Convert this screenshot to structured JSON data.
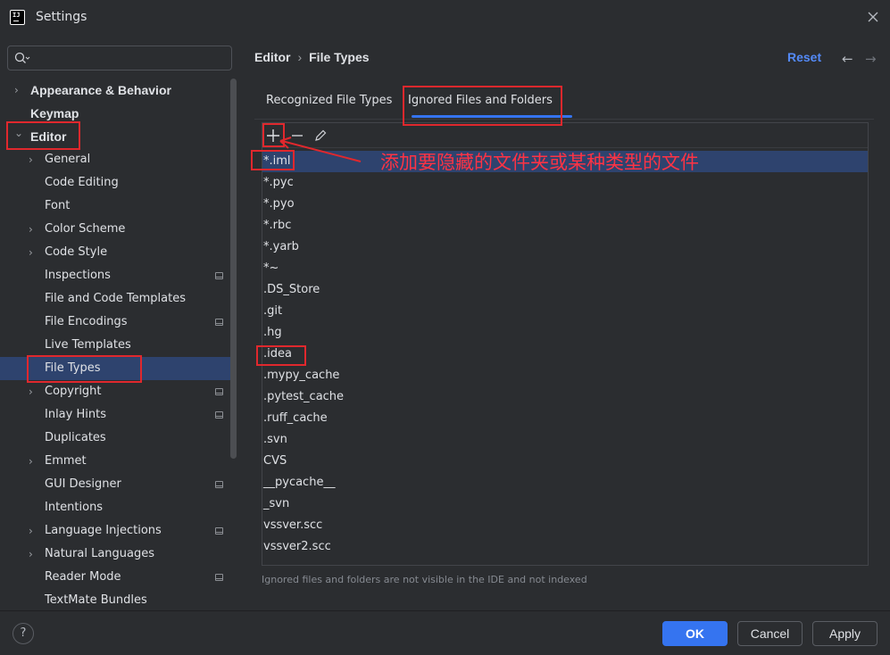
{
  "window": {
    "title": "Settings",
    "logo_text": "IJ"
  },
  "search": {
    "placeholder": "",
    "value": ""
  },
  "sidebar": {
    "items": [
      {
        "label": "Appearance & Behavior",
        "level": 0,
        "chevron": "right",
        "bold": true
      },
      {
        "label": "Keymap",
        "level": 0,
        "chevron": "",
        "bold": true
      },
      {
        "label": "Editor",
        "level": 0,
        "chevron": "down",
        "bold": true
      },
      {
        "label": "General",
        "level": 1,
        "chevron": "right"
      },
      {
        "label": "Code Editing",
        "level": 1,
        "chevron": ""
      },
      {
        "label": "Font",
        "level": 1,
        "chevron": ""
      },
      {
        "label": "Color Scheme",
        "level": 1,
        "chevron": "right"
      },
      {
        "label": "Code Style",
        "level": 1,
        "chevron": "right"
      },
      {
        "label": "Inspections",
        "level": 1,
        "chevron": "",
        "project_icon": true
      },
      {
        "label": "File and Code Templates",
        "level": 1,
        "chevron": ""
      },
      {
        "label": "File Encodings",
        "level": 1,
        "chevron": "",
        "project_icon": true
      },
      {
        "label": "Live Templates",
        "level": 1,
        "chevron": ""
      },
      {
        "label": "File Types",
        "level": 1,
        "chevron": "",
        "selected": true
      },
      {
        "label": "Copyright",
        "level": 1,
        "chevron": "right",
        "project_icon": true
      },
      {
        "label": "Inlay Hints",
        "level": 1,
        "chevron": "",
        "project_icon": true
      },
      {
        "label": "Duplicates",
        "level": 1,
        "chevron": ""
      },
      {
        "label": "Emmet",
        "level": 1,
        "chevron": "right"
      },
      {
        "label": "GUI Designer",
        "level": 1,
        "chevron": "",
        "project_icon": true
      },
      {
        "label": "Intentions",
        "level": 1,
        "chevron": ""
      },
      {
        "label": "Language Injections",
        "level": 1,
        "chevron": "right",
        "project_icon": true
      },
      {
        "label": "Natural Languages",
        "level": 1,
        "chevron": "right"
      },
      {
        "label": "Reader Mode",
        "level": 1,
        "chevron": "",
        "project_icon": true
      },
      {
        "label": "TextMate Bundles",
        "level": 1,
        "chevron": ""
      }
    ]
  },
  "header": {
    "breadcrumb": [
      "Editor",
      "File Types"
    ],
    "reset_label": "Reset",
    "back_icon": "arrow-left-icon",
    "forward_icon": "arrow-right-icon"
  },
  "tabs": [
    {
      "label": "Recognized File Types",
      "active": false
    },
    {
      "label": "Ignored Files and Folders",
      "active": true
    }
  ],
  "toolbar": {
    "add_icon": "plus-icon",
    "remove_icon": "minus-icon",
    "edit_icon": "pencil-icon"
  },
  "ignored_list": [
    "*.iml",
    "*.pyc",
    "*.pyo",
    "*.rbc",
    "*.yarb",
    "*~",
    ".DS_Store",
    ".git",
    ".hg",
    ".idea",
    ".mypy_cache",
    ".pytest_cache",
    ".ruff_cache",
    ".svn",
    "CVS",
    "__pycache__",
    "_svn",
    "vssver.scc",
    "vssver2.scc"
  ],
  "selected_index": 0,
  "hint": "Ignored files and folders are not visible in the IDE and not indexed",
  "annotation": {
    "text": "添加要隐藏的文件夹或某种类型的文件",
    "color": "#ff3344"
  },
  "footer": {
    "help_label": "?",
    "ok_label": "OK",
    "cancel_label": "Cancel",
    "apply_label": "Apply"
  },
  "colors": {
    "accent": "#3574f0",
    "selection": "#2e436e",
    "annotation_red": "#e0282d",
    "background": "#2b2d30"
  }
}
